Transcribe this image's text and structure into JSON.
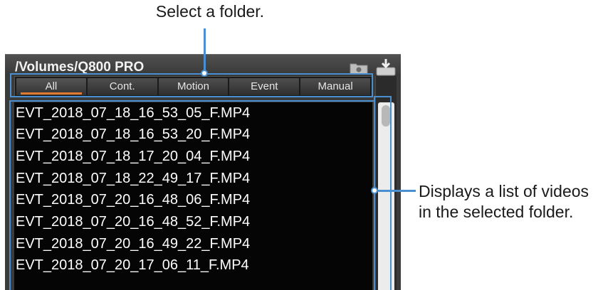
{
  "callouts": {
    "top": "Select a folder.",
    "right_line1": "Displays a list of videos",
    "right_line2": "in the selected folder."
  },
  "window": {
    "path_title": "/Volumes/Q800 PRO",
    "icons": [
      "folder-icon",
      "download-icon"
    ]
  },
  "tabs": [
    {
      "label": "All",
      "active": true
    },
    {
      "label": "Cont.",
      "active": false
    },
    {
      "label": "Motion",
      "active": false
    },
    {
      "label": "Event",
      "active": false
    },
    {
      "label": "Manual",
      "active": false
    }
  ],
  "files": [
    "EVT_2018_07_18_16_53_05_F.MP4",
    "EVT_2018_07_18_16_53_20_F.MP4",
    "EVT_2018_07_18_17_20_04_F.MP4",
    "EVT_2018_07_18_22_49_17_F.MP4",
    "EVT_2018_07_20_16_48_06_F.MP4",
    "EVT_2018_07_20_16_48_52_F.MP4",
    "EVT_2018_07_20_16_49_22_F.MP4",
    "EVT_2018_07_20_17_06_11_F.MP4"
  ],
  "colors": {
    "accent": "#4a8fd0",
    "active_tab_underline": "#e07a30",
    "list_background": "#050505"
  }
}
